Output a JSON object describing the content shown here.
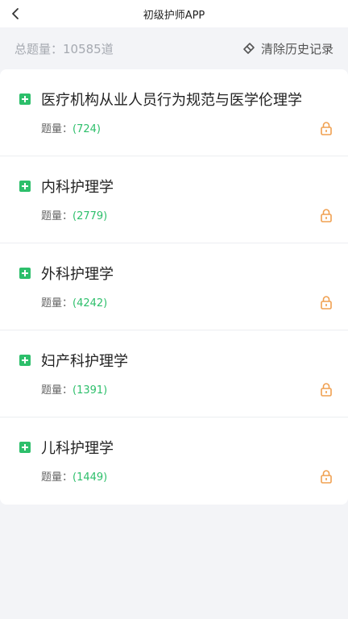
{
  "nav": {
    "title": "初级护师APP"
  },
  "summary": {
    "total_label": "总题量：10585道",
    "clear_label": "清除历史记录"
  },
  "subjects": [
    {
      "name": "医疗机构从业人员行为规范与医学伦理学",
      "count_label": "题量：",
      "count": "(724)"
    },
    {
      "name": "内科护理学",
      "count_label": "题量：",
      "count": "(2779)"
    },
    {
      "name": "外科护理学",
      "count_label": "题量：",
      "count": "(4242)"
    },
    {
      "name": "妇产科护理学",
      "count_label": "题量：",
      "count": "(1391)"
    },
    {
      "name": "儿科护理学",
      "count_label": "题量：",
      "count": "(1449)"
    }
  ],
  "colors": {
    "accent_green": "#2dbf6b",
    "lock_orange": "#f0a050"
  },
  "icons": [
    "back-arrow-icon",
    "eraser-icon",
    "plus-square-icon",
    "lock-icon"
  ]
}
